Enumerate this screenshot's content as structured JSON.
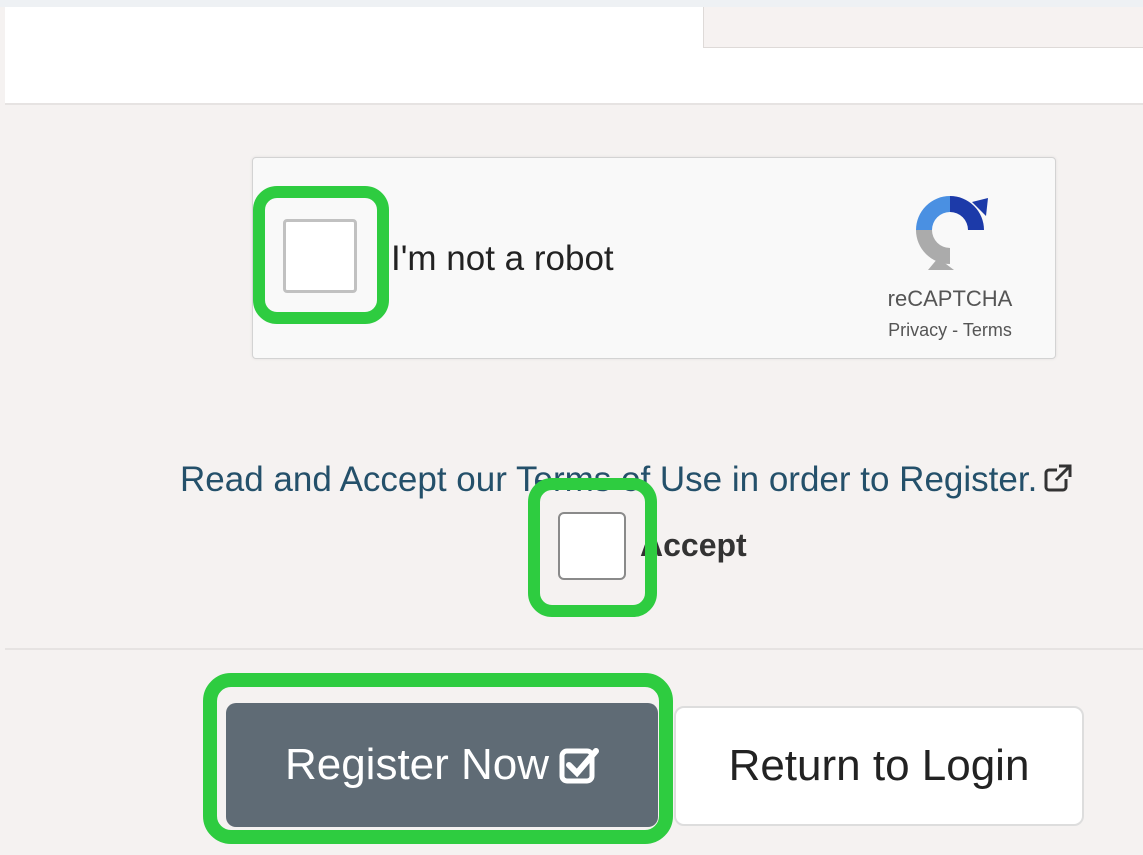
{
  "recaptcha": {
    "checkbox_label": "I'm not a robot",
    "brand": "reCAPTCHA",
    "privacy_link": "Privacy",
    "separator": " - ",
    "terms_link": "Terms"
  },
  "terms": {
    "text": "Read and Accept our Terms of Use in order to Register.",
    "accept_label": "Accept",
    "icon": "external-link-icon"
  },
  "buttons": {
    "register_label": "Register Now",
    "register_icon": "check-square-icon",
    "login_label": "Return to Login"
  },
  "colors": {
    "highlight": "#2ecc40",
    "register_bg": "#5f6b75",
    "link_text": "#24506a",
    "recaptcha_blue": "#1c3aa9",
    "recaptcha_light_blue": "#4a90e2"
  }
}
